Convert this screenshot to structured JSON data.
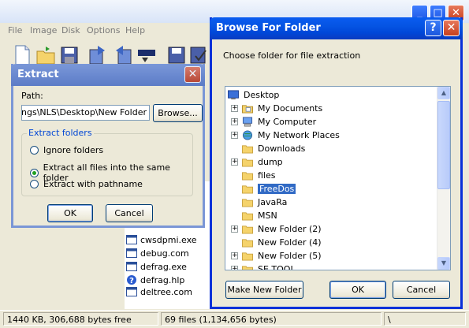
{
  "main": {
    "menu": [
      "File",
      "Image",
      "Disk",
      "Options",
      "Help"
    ],
    "files": [
      {
        "name": "cwsdpmi.exe",
        "icon": "exe-icon"
      },
      {
        "name": "debug.com",
        "icon": "exe-icon"
      },
      {
        "name": "defrag.exe",
        "icon": "exe-icon"
      },
      {
        "name": "defrag.hlp",
        "icon": "help-file-icon"
      },
      {
        "name": "deltree.com",
        "icon": "exe-icon"
      }
    ],
    "status": {
      "free": "1440 KB, 306,688 bytes free",
      "files": "69 files (1,134,656 bytes)",
      "path": "\\"
    }
  },
  "extract": {
    "title": "Extract",
    "path_label": "Path:",
    "path_value": "ttings\\NLS\\Desktop\\New Folder",
    "browse_label": "Browse...",
    "group_label": "Extract folders",
    "options": [
      {
        "label": "Ignore folders",
        "checked": false
      },
      {
        "label": "Extract all files into the same folder",
        "checked": true
      },
      {
        "label": "Extract with pathname",
        "checked": false
      }
    ],
    "ok_label": "OK",
    "cancel_label": "Cancel"
  },
  "browse": {
    "title": "Browse For Folder",
    "help_glyph": "?",
    "close_glyph": "✕",
    "prompt": "Choose folder for file extraction",
    "tree": [
      {
        "label": "Desktop",
        "icon": "desktop-icon",
        "level": 0,
        "expander": ""
      },
      {
        "label": "My Documents",
        "icon": "my-documents-icon",
        "level": 1,
        "expander": "+"
      },
      {
        "label": "My Computer",
        "icon": "my-computer-icon",
        "level": 1,
        "expander": "+"
      },
      {
        "label": "My Network Places",
        "icon": "network-places-icon",
        "level": 1,
        "expander": "+"
      },
      {
        "label": "Downloads",
        "icon": "folder-icon",
        "level": 1,
        "expander": ""
      },
      {
        "label": "dump",
        "icon": "folder-icon",
        "level": 1,
        "expander": "+"
      },
      {
        "label": "files",
        "icon": "folder-icon",
        "level": 1,
        "expander": ""
      },
      {
        "label": "FreeDos",
        "icon": "folder-icon",
        "level": 1,
        "expander": "",
        "selected": true
      },
      {
        "label": "JavaRa",
        "icon": "folder-icon",
        "level": 1,
        "expander": ""
      },
      {
        "label": "MSN",
        "icon": "folder-icon",
        "level": 1,
        "expander": ""
      },
      {
        "label": "New Folder (2)",
        "icon": "folder-icon",
        "level": 1,
        "expander": "+"
      },
      {
        "label": "New Folder (4)",
        "icon": "folder-icon",
        "level": 1,
        "expander": ""
      },
      {
        "label": "New Folder (5)",
        "icon": "folder-icon",
        "level": 1,
        "expander": "+"
      },
      {
        "label": "SE TOOL",
        "icon": "folder-icon",
        "level": 1,
        "expander": "+"
      }
    ],
    "make_folder_label": "Make New Folder",
    "ok_label": "OK",
    "cancel_label": "Cancel"
  },
  "colors": {
    "title_blue": "#0054e3",
    "selection": "#316ac5",
    "dialog_face": "#ece9d8",
    "folder_yellow": "#f5d36b"
  }
}
